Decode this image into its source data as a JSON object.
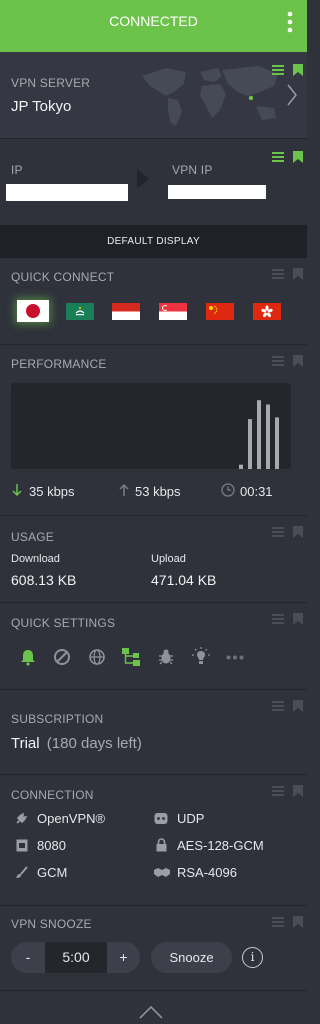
{
  "header": {
    "status": "CONNECTED",
    "bg": "#6cc34a"
  },
  "vpn_server": {
    "label": "VPN SERVER",
    "value": "JP Tokyo"
  },
  "ip": {
    "label": "IP",
    "vpn_label": "VPN IP"
  },
  "default_display": {
    "label": "DEFAULT DISPLAY"
  },
  "quick_connect": {
    "label": "QUICK CONNECT",
    "flags": [
      {
        "name": "japan"
      },
      {
        "name": "macau"
      },
      {
        "name": "indonesia"
      },
      {
        "name": "singapore"
      },
      {
        "name": "china"
      },
      {
        "name": "hong-kong"
      }
    ]
  },
  "performance": {
    "label": "PERFORMANCE",
    "down": "35 kbps",
    "up": "53 kbps",
    "time": "00:31",
    "bars": [
      0.05,
      0.58,
      0.8,
      0.75,
      0.6
    ]
  },
  "usage": {
    "label": "USAGE",
    "download_label": "Download",
    "download_value": "608.13 KB",
    "upload_label": "Upload",
    "upload_value": "471.04 KB"
  },
  "quick_settings": {
    "label": "QUICK SETTINGS",
    "icons": [
      "bell-icon",
      "block-icon",
      "globe-icon",
      "network-icon",
      "bug-icon",
      "bulb-icon",
      "more-icon"
    ]
  },
  "subscription": {
    "label": "SUBSCRIPTION",
    "plan": "Trial",
    "remaining": "(180 days left)"
  },
  "connection": {
    "label": "CONNECTION",
    "protocol": "OpenVPN®",
    "transport": "UDP",
    "port": "8080",
    "cipher": "AES-128-GCM",
    "mode": "GCM",
    "key": "RSA-4096"
  },
  "snooze": {
    "label": "VPN SNOOZE",
    "minus": "-",
    "time": "5:00",
    "plus": "+",
    "button": "Snooze",
    "info": "i"
  },
  "colors": {
    "accent": "#6cc34a",
    "bg": "#2f323b",
    "panel": "#24262c"
  }
}
